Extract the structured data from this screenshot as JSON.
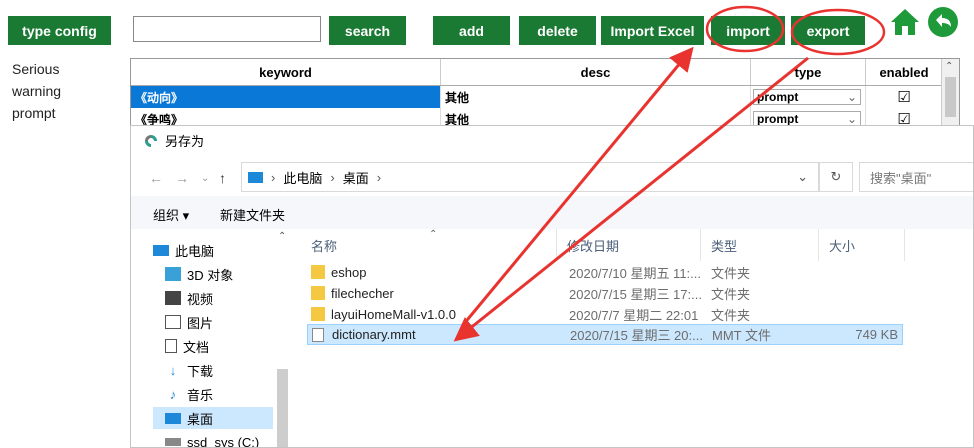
{
  "toolbar": {
    "type_config": "type config",
    "search_placeholder": "",
    "search": "search",
    "add": "add",
    "delete": "delete",
    "import_excel": "Import Excel",
    "import": "import",
    "export": "export"
  },
  "side_labels": [
    "Serious",
    "warning",
    "prompt"
  ],
  "grid": {
    "headers": [
      "keyword",
      "desc",
      "type",
      "enabled"
    ],
    "rows": [
      {
        "keyword": "《动向》",
        "desc": "其他",
        "type": "prompt",
        "enabled": "☑"
      },
      {
        "keyword": "《争鸣》",
        "desc": "其他",
        "type": "prompt",
        "enabled": "☑"
      }
    ]
  },
  "dialog": {
    "title": "另存为",
    "path": [
      "此电脑",
      "桌面"
    ],
    "search_placeholder": "搜索\"桌面\"",
    "organize": "组织 ▾",
    "new_folder": "新建文件夹",
    "nav": [
      "此电脑",
      "3D 对象",
      "视频",
      "图片",
      "文档",
      "下载",
      "音乐",
      "桌面",
      "ssd_sys (C:)"
    ],
    "columns": [
      "名称",
      "修改日期",
      "类型",
      "大小"
    ],
    "files": [
      {
        "name": "eshop",
        "date": "2020/7/10 星期五 11:...",
        "type": "文件夹",
        "size": ""
      },
      {
        "name": "filechecher",
        "date": "2020/7/15 星期三 17:...",
        "type": "文件夹",
        "size": ""
      },
      {
        "name": "layuiHomeMall-v1.0.0",
        "date": "2020/7/7 星期二 22:01",
        "type": "文件夹",
        "size": ""
      },
      {
        "name": "dictionary.mmt",
        "date": "2020/7/15 星期三 20:...",
        "type": "MMT 文件",
        "size": "749 KB"
      }
    ]
  },
  "colors": {
    "button_green": "#1a7a33",
    "selection_blue": "#0a78d7",
    "annotation_red": "#e8332f"
  }
}
